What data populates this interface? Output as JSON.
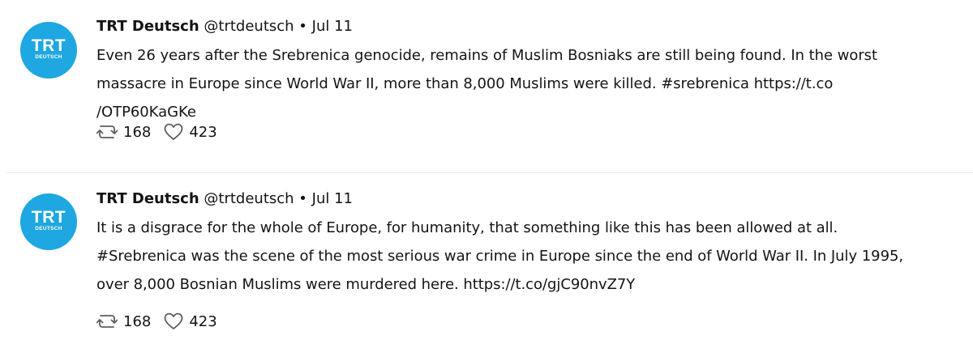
{
  "tweets": [
    {
      "avatar": {
        "logo_main": "TRT",
        "logo_sub": "DEUTSCH"
      },
      "name": "TRT Deutsch",
      "handle": "@trtdeutsch",
      "separator": "•",
      "date": "Jul 11",
      "text_lines": [
        "Even 26 years after the Srebrenica genocide, remains of Muslim Bosniaks are still being found. In the worst",
        "massacre in Europe since World War II, more than 8,000 Muslims were killed. #srebrenica https://t.co",
        "/OTP60KaGKe"
      ],
      "retweets": "168",
      "likes": "423"
    },
    {
      "avatar": {
        "logo_main": "TRT",
        "logo_sub": "DEUTSCH"
      },
      "name": "TRT Deutsch",
      "handle": "@trtdeutsch",
      "separator": "•",
      "date": "Jul 11",
      "text_lines": [
        "It is a disgrace for the whole of Europe, for humanity, that something like this has been allowed at all.",
        "#Srebrenica was the scene of the most serious war crime in Europe since the end of World War II. In July 1995,",
        "over 8,000 Bosnian Muslims were murdered here. https://t.co/gjC90nvZ7Y"
      ],
      "retweets": "168",
      "likes": "423"
    }
  ],
  "icons": {
    "retweet": "retweet-icon",
    "like": "heart-icon"
  },
  "colors": {
    "avatar_bg": "#1ea7e0",
    "text": "#141414",
    "divider": "#e3e6e8"
  }
}
